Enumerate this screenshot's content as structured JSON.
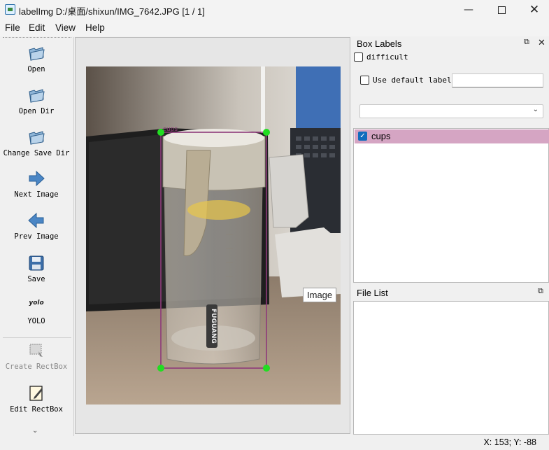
{
  "window": {
    "title": "labelImg D:/桌面/shixun/IMG_7642.JPG [1 / 1]",
    "min_icon": "minimize-icon",
    "max_icon": "maximize-icon",
    "close_icon": "close-icon"
  },
  "menubar": {
    "items": [
      "File",
      "Edit",
      "View",
      "Help"
    ]
  },
  "toolbar": {
    "tools": [
      {
        "label": "Open",
        "icon": "open-folder-icon",
        "enabled": true
      },
      {
        "label": "Open Dir",
        "icon": "open-dir-icon",
        "enabled": true
      },
      {
        "label": "Change Save Dir",
        "icon": "change-save-dir-icon",
        "enabled": true
      },
      {
        "label": "Next Image",
        "icon": "arrow-right-icon",
        "enabled": true
      },
      {
        "label": "Prev Image",
        "icon": "arrow-left-icon",
        "enabled": true
      },
      {
        "label": "Save",
        "icon": "floppy-disk-icon",
        "enabled": true
      },
      {
        "label": "YOLO",
        "icon_text": "yolo",
        "icon": "yolo-format-icon",
        "enabled": true
      },
      {
        "label": "Create RectBox",
        "icon": "create-rectbox-icon",
        "enabled": false
      },
      {
        "label": "Edit RectBox",
        "icon": "edit-rectbox-icon",
        "enabled": true
      }
    ],
    "more_icon": "chevron-double-down-icon"
  },
  "canvas": {
    "tooltip": "Image",
    "box_color": "#8e3a7a",
    "handle_color": "#22dd22"
  },
  "box_labels_panel": {
    "title": "Box Labels",
    "difficult_label": "difficult",
    "difficult_checked": false,
    "use_default_label": "Use default label",
    "use_default_checked": false,
    "default_label_value": "",
    "combo_value": "",
    "labels": [
      {
        "text": "cups",
        "checked": true,
        "color": "#d5a5c3"
      }
    ]
  },
  "file_list_panel": {
    "title": "File List",
    "files": []
  },
  "status": {
    "coords": "X: 153; Y: -88"
  }
}
